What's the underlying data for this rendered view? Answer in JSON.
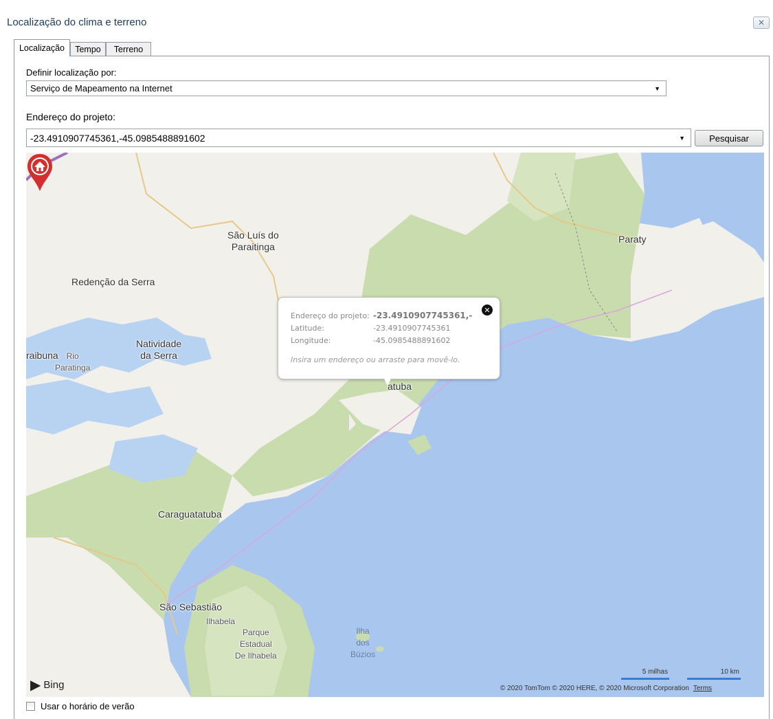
{
  "window": {
    "title": "Localização do clima e terreno",
    "close_icon": "close-icon"
  },
  "tabs": [
    {
      "label": "Localização",
      "active": true
    },
    {
      "label": "Tempo",
      "active": false
    },
    {
      "label": "Terreno",
      "active": false
    }
  ],
  "location_method": {
    "label": "Definir localização por:",
    "value": "Serviço de Mapeamento na Internet"
  },
  "address": {
    "label": "Endereço do projeto:",
    "value": "-23.4910907745361,-45.0985488891602",
    "search_button": "Pesquisar"
  },
  "map": {
    "places": [
      {
        "id": "sao-luis",
        "text": "São Luís do\nParaitinga"
      },
      {
        "id": "paraty",
        "text": "Paraty"
      },
      {
        "id": "redencao",
        "text": "Redenção da Serra"
      },
      {
        "id": "natividade",
        "text": "Natividade\nda Serra"
      },
      {
        "id": "paraibuna",
        "text": "raibuna"
      },
      {
        "id": "rio-paratinga",
        "text": "Rio\nParatinga"
      },
      {
        "id": "ubatuba",
        "text": "atuba"
      },
      {
        "id": "caraguatatuba",
        "text": "Caraguatatuba"
      },
      {
        "id": "sao-sebastiao",
        "text": "São Sebastião"
      },
      {
        "id": "ilhabela",
        "text": "Ilhabela"
      },
      {
        "id": "parque",
        "text": "Parque\nEstadual\nDe Ilhabela"
      },
      {
        "id": "ilha-buzios",
        "text": "Ilha\ndos\nBúzios"
      }
    ],
    "popup": {
      "address_label": "Endereço do projeto:",
      "address_value": "-23.4910907745361,-",
      "latitude_label": "Latitude:",
      "latitude_value": "-23.4910907745361",
      "longitude_label": "Longitude:",
      "longitude_value": "-45.0985488891602",
      "hint": "Insira um endereço ou arraste para movê-lo."
    },
    "brand": "Bing",
    "scale_miles": "5 milhas",
    "scale_km": "10 km",
    "copyright": "© 2020 TomTom © 2020 HERE, © 2020 Microsoft Corporation",
    "terms": "Terms"
  },
  "dst": {
    "label": "Usar o horário de verão",
    "checked": false
  },
  "colors": {
    "water": "#a9c7ee",
    "land": "#f2f0ea",
    "forest": "#c9dcae",
    "pin": "#d32f2f"
  }
}
